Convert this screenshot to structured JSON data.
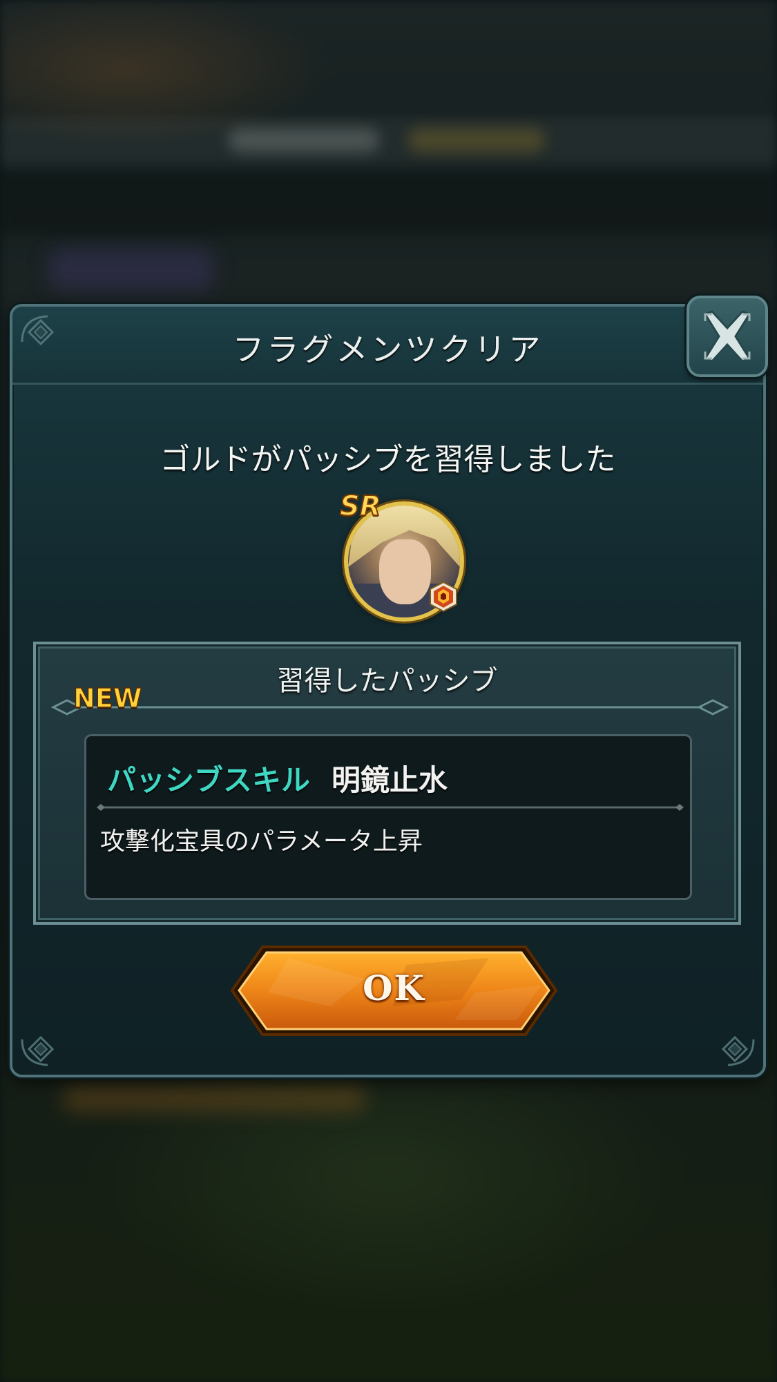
{
  "dialog": {
    "title": "フラグメンツクリア",
    "message": "ゴルドがパッシブを習得しました",
    "close_icon": "close-icon"
  },
  "character": {
    "rarity": "SR",
    "portrait_icon": "character-portrait",
    "element_icon": "fire-element-icon"
  },
  "passive_panel": {
    "title": "習得したパッシブ",
    "new_label": "NEW",
    "skill_type": "パッシブスキル",
    "skill_name": "明鏡止水",
    "skill_description": "攻撃化宝具のパラメータ上昇"
  },
  "ok_button": {
    "label": "OK"
  },
  "colors": {
    "dialog_bg": "#12282d",
    "dialog_border": "#4f7378",
    "skill_type_teal": "#3fd6c2",
    "new_gold": "#ffd13a",
    "ok_orange": "#e8841a"
  }
}
